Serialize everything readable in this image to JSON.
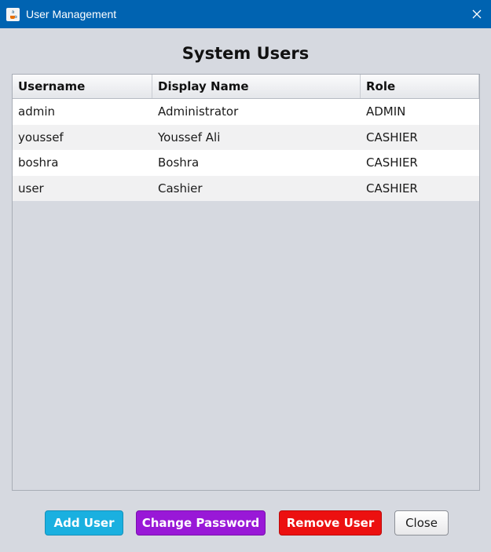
{
  "window": {
    "title": "User Management"
  },
  "heading": "System Users",
  "table": {
    "columns": [
      "Username",
      "Display Name",
      "Role"
    ],
    "rows": [
      [
        "admin",
        "Administrator",
        "ADMIN"
      ],
      [
        "youssef",
        "Youssef Ali",
        "CASHIER"
      ],
      [
        "boshra",
        "Boshra",
        "CASHIER"
      ],
      [
        "user",
        "Cashier",
        "CASHIER"
      ]
    ]
  },
  "buttons": {
    "add": "Add User",
    "change_password": "Change Password",
    "remove": "Remove User",
    "close": "Close"
  },
  "colors": {
    "titlebar": "#0063b1",
    "add": "#1ab0e0",
    "change_password": "#9918d7",
    "remove": "#ec1010"
  },
  "icons": {
    "app": "java-app-icon",
    "close": "close-icon"
  }
}
